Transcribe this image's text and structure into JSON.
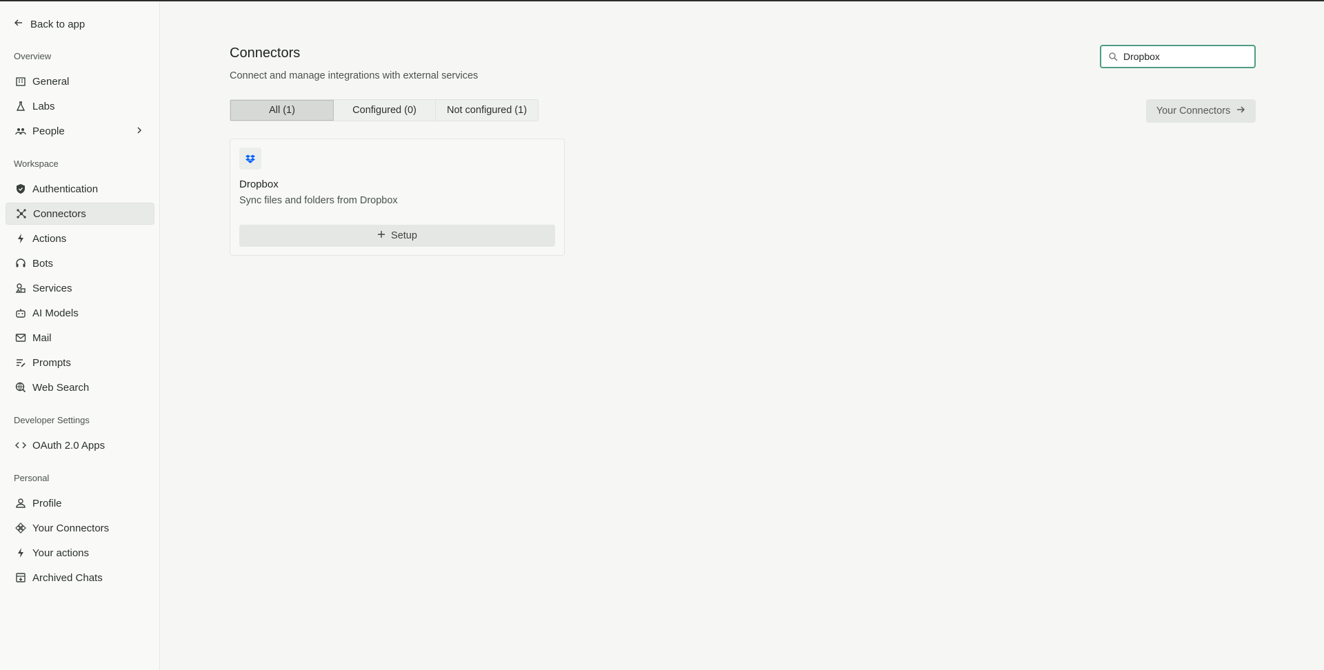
{
  "sidebar": {
    "back_label": "Back to app",
    "sections": {
      "overview": "Overview",
      "workspace": "Workspace",
      "developer": "Developer Settings",
      "personal": "Personal"
    },
    "items": {
      "general": "General",
      "labs": "Labs",
      "people": "People",
      "authentication": "Authentication",
      "connectors": "Connectors",
      "actions": "Actions",
      "bots": "Bots",
      "services": "Services",
      "ai_models": "AI Models",
      "mail": "Mail",
      "prompts": "Prompts",
      "web_search": "Web Search",
      "oauth_apps": "OAuth 2.0 Apps",
      "profile": "Profile",
      "your_connectors": "Your Connectors",
      "your_actions": "Your actions",
      "archived_chats": "Archived Chats"
    },
    "active_item": "Connectors"
  },
  "main": {
    "title": "Connectors",
    "subtitle": "Connect and manage integrations with external services",
    "search": {
      "value": "Dropbox"
    },
    "tabs": [
      {
        "label": "All (1)",
        "active": true
      },
      {
        "label": "Configured (0)",
        "active": false
      },
      {
        "label": "Not configured (1)",
        "active": false
      }
    ],
    "your_connectors_button": "Your Connectors",
    "cards": [
      {
        "name": "Dropbox",
        "description": "Sync files and folders from Dropbox",
        "logo_icon": "dropbox-icon",
        "setup_label": "Setup"
      }
    ]
  },
  "colors": {
    "accent_border": "#4d9c84",
    "dropbox_blue": "#0061fe"
  }
}
